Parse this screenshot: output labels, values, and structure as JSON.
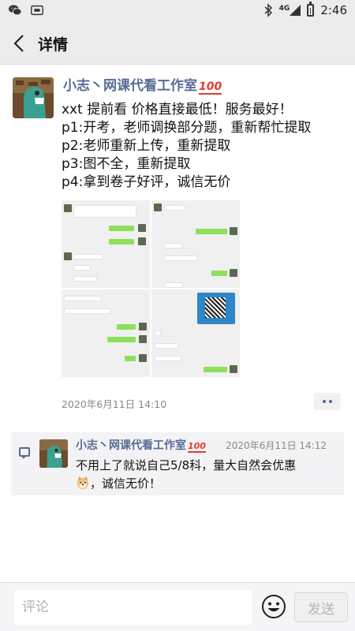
{
  "status_bar": {
    "icons": [
      "wechat-icon",
      "sim-card-icon",
      "bluetooth-icon",
      "signal-4g-icon",
      "battery-icon"
    ],
    "network": "4G",
    "time": "2:46"
  },
  "header": {
    "title": "详情"
  },
  "post": {
    "author": "小志丶网课代看工作室",
    "author_emoji": "100",
    "lines": [
      "xxt  提前看   价格直接最低！服务最好！",
      "p1:开考，老师调换部分题，重新帮忙提取",
      "p2:老师重新上传，重新提取",
      "p3:图不全，重新提取",
      "p4:拿到卷子好评，诚信无价"
    ],
    "time": "2020年6月11日 14:10"
  },
  "comment": {
    "author": "小志丶网课代看工作室",
    "author_emoji": "100",
    "time": "2020年6月11日 14:12",
    "text_line1": "不用上了就说自己5/8科，量大自然会优惠",
    "text_line2": "，诚信无价！"
  },
  "input_bar": {
    "placeholder": "评论",
    "send_label": "发送"
  },
  "colors": {
    "link_blue": "#576b95",
    "bar_bg": "#ececec",
    "comment_bg": "#f3f3f5",
    "bubble_green": "#8ee05a"
  }
}
